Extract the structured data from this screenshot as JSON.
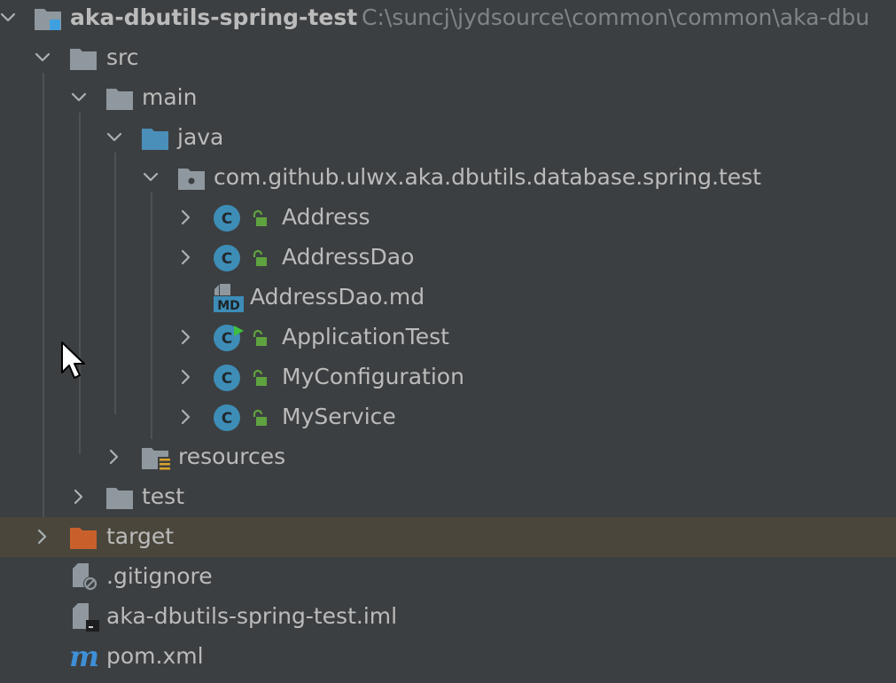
{
  "project": {
    "name": "aka-dbutils-spring-test",
    "path": "C:\\suncj\\jydsource\\common\\common\\aka-dbu"
  },
  "tree": {
    "src": "src",
    "main": "main",
    "java": "java",
    "package": "com.github.ulwx.aka.dbutils.database.spring.test",
    "classes": {
      "address": "Address",
      "address_dao": "AddressDao",
      "application_test": "ApplicationTest",
      "my_configuration": "MyConfiguration",
      "my_service": "MyService"
    },
    "markdown_file": "AddressDao.md",
    "resources": "resources",
    "test": "test",
    "target": "target",
    "gitignore": ".gitignore",
    "iml_file": "aka-dbutils-spring-test.iml",
    "pom": "pom.xml"
  },
  "icon_labels": {
    "class_letter": "C",
    "md_badge": "MD",
    "maven_letter": "m"
  },
  "colors": {
    "background": "#3c3f41",
    "selected_row": "#4b463c",
    "text": "#bbbbbb",
    "path_text": "#808487",
    "folder": "#8f989e",
    "source_folder": "#4a8fba",
    "excluded_folder": "#c9602b",
    "class_icon": "#3d8db7",
    "lock_green": "#5fa340",
    "resources_badge": "#d9a12b",
    "maven": "#3f8fd6"
  }
}
